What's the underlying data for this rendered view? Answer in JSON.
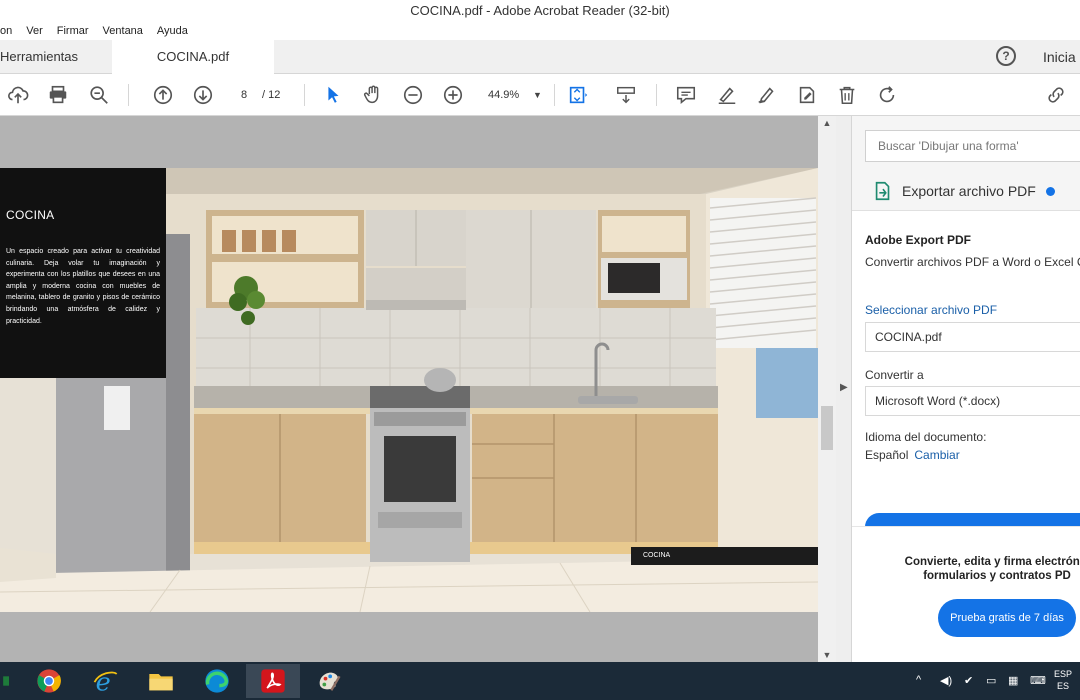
{
  "window": {
    "title": "COCINA.pdf - Adobe Acrobat Reader (32-bit)"
  },
  "menu": {
    "items": [
      "on",
      "Ver",
      "Firmar",
      "Ventana",
      "Ayuda"
    ]
  },
  "tabs": {
    "tools": "Herramientas",
    "document": "COCINA.pdf",
    "help": "?",
    "signin": "Inicia"
  },
  "toolbar": {
    "current_page": "8",
    "total_pages": "/ 12",
    "zoom": "44.9%"
  },
  "pdf": {
    "heading": "COCINA",
    "body": "Un espacio creado para activar tu creatividad culinaria. Deja volar tu imaginación y experimenta con los platillos que desees en una amplia y moderna cocina con muebles de melanina, tablero de granito y pisos de cerámico brindando una atmósfera de calidez y practicidad.",
    "footer_label": "COCINA"
  },
  "right_panel": {
    "search_placeholder": "Buscar 'Dibujar una forma'",
    "export_label": "Exportar archivo PDF",
    "card_title": "Adobe Export PDF",
    "card_sub": "Convertir archivos PDF a Word o Excel C",
    "select_label": "Seleccionar archivo PDF",
    "file_name": "COCINA.pdf",
    "convert_label": "Convertir a",
    "convert_value": "Microsoft Word (*.docx)",
    "lang_label": "Idioma del documento:",
    "lang_value": "Español",
    "lang_change": "Cambiar",
    "promo_line1": "Convierte, edita y firma electrónic",
    "promo_line2": "formularios y contratos PD",
    "promo_button": "Prueba gratis de 7 días"
  },
  "taskbar": {
    "lang_top": "ESP",
    "lang_bottom": "ES"
  },
  "colors": {
    "accent": "#1473e6",
    "taskbar": "#1b2a38",
    "link": "#1a5fa8"
  }
}
